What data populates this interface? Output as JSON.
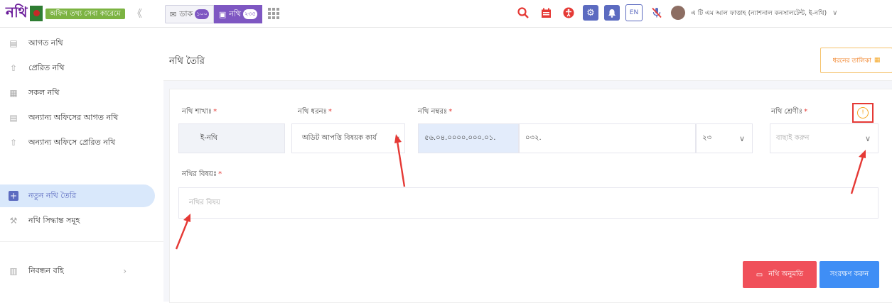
{
  "header": {
    "logo_text": "নথি",
    "logo_badge": "অফিস তথ্য সেবা কারেমে",
    "collapse": "《",
    "dak": {
      "label": "ডাক",
      "count": "১০০"
    },
    "nothi": {
      "label": "নথি",
      "count": "২৩৫"
    },
    "lang": "EN",
    "user": "এ টি এম আল ফাত্তাহ (ন্যাশনাল কনসালটেন্ট, ই-নথি)"
  },
  "sidebar": {
    "items": [
      {
        "label": "আগত নথি"
      },
      {
        "label": "প্রেরিত নথি"
      },
      {
        "label": "সকল নথি"
      },
      {
        "label": "অন্যান্য অফিসের আগত নথি"
      },
      {
        "label": "অন্যান্য অফিসে প্রেরিত নথি"
      },
      {
        "label": "নতুন নথি তৈরি"
      },
      {
        "label": "নথি সিদ্ধান্ত সমূহ"
      },
      {
        "label": "নিবন্ধন বহি"
      }
    ]
  },
  "main": {
    "title": "নথি তৈরি",
    "list_button": "ধরনের তালিকা",
    "form": {
      "shakha_label": "নথি শাখাঃ",
      "shakha_value": "ই-নথি",
      "dhoron_label": "নথি ধরনঃ",
      "dhoron_value": "অডিট আপত্তি বিষয়ক কার্য",
      "nombor_label": "নথি নম্বরঃ",
      "nombor_prefix": "৫৬.০৪.০০০০.০০০.০১.",
      "nombor_code": "০৩২.",
      "nombor_year": "২৩",
      "shreni_label": "নথি শ্রেণীঃ",
      "shreni_placeholder": "বাছাই করুন",
      "bishoy_label": "নথির বিষয়ঃ",
      "bishoy_placeholder": "নথির বিষয়",
      "required_mark": "*"
    },
    "buttons": {
      "onumoti": "নথি অনুমতি",
      "songrokkhon": "সংরক্ষণ করুন"
    }
  },
  "colors": {
    "accent": "#5c6bc0",
    "red": "#e53935",
    "save": "#3f8ef5"
  }
}
